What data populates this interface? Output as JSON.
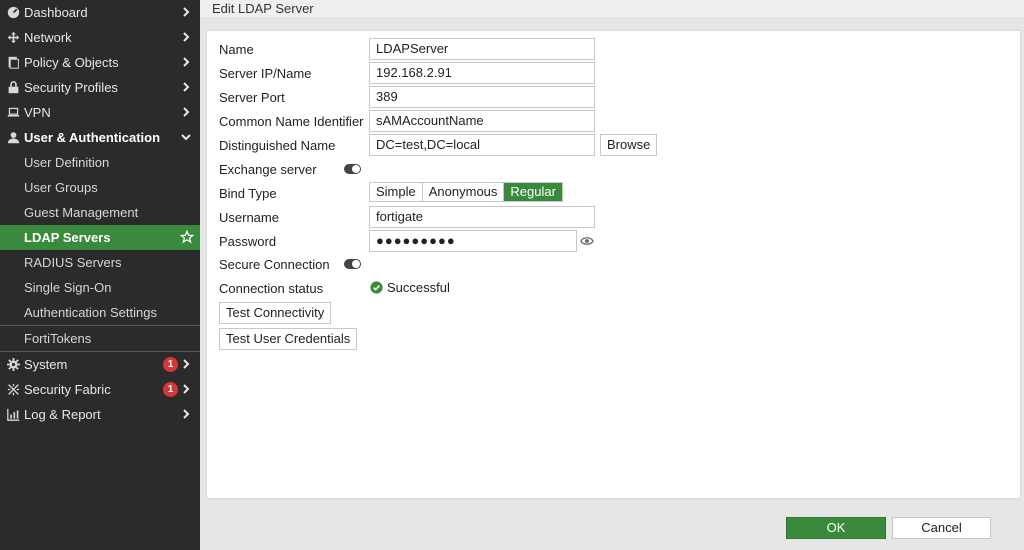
{
  "sidebar": {
    "items": [
      {
        "label": "Dashboard",
        "icon": "dashboard-icon"
      },
      {
        "label": "Network",
        "icon": "network-icon"
      },
      {
        "label": "Policy & Objects",
        "icon": "policy-icon"
      },
      {
        "label": "Security Profiles",
        "icon": "lock-icon"
      },
      {
        "label": "VPN",
        "icon": "laptop-icon"
      },
      {
        "label": "User & Authentication",
        "icon": "user-icon"
      }
    ],
    "subitems": [
      {
        "label": "User Definition"
      },
      {
        "label": "User Groups"
      },
      {
        "label": "Guest Management"
      },
      {
        "label": "LDAP Servers"
      },
      {
        "label": "RADIUS Servers"
      },
      {
        "label": "Single Sign-On"
      },
      {
        "label": "Authentication Settings"
      },
      {
        "label": "FortiTokens"
      }
    ],
    "bottom_items": [
      {
        "label": "System",
        "icon": "gear-icon",
        "badge": "1"
      },
      {
        "label": "Security Fabric",
        "icon": "fabric-icon",
        "badge": "1"
      },
      {
        "label": "Log & Report",
        "icon": "chart-icon"
      }
    ],
    "accent_color": "#3a8a3e"
  },
  "page": {
    "title": "Edit LDAP Server"
  },
  "form": {
    "name_label": "Name",
    "name_value": "LDAPServer",
    "server_label": "Server IP/Name",
    "server_value": "192.168.2.91",
    "port_label": "Server Port",
    "port_value": "389",
    "cn_label": "Common Name Identifier",
    "cn_value": "sAMAccountName",
    "dn_label": "Distinguished Name",
    "dn_value": "DC=test,DC=local",
    "browse_label": "Browse",
    "exchange_label": "Exchange server",
    "exchange_on": false,
    "bind_label": "Bind Type",
    "bind_options": [
      "Simple",
      "Anonymous",
      "Regular"
    ],
    "bind_selected": "Regular",
    "username_label": "Username",
    "username_value": "fortigate",
    "password_label": "Password",
    "password_value": "●●●●●●●●●",
    "secure_label": "Secure Connection",
    "secure_on": false,
    "status_label": "Connection status",
    "status_value": "Successful",
    "test_conn_label": "Test Connectivity",
    "test_cred_label": "Test User Credentials"
  },
  "footer": {
    "ok_label": "OK",
    "cancel_label": "Cancel"
  }
}
